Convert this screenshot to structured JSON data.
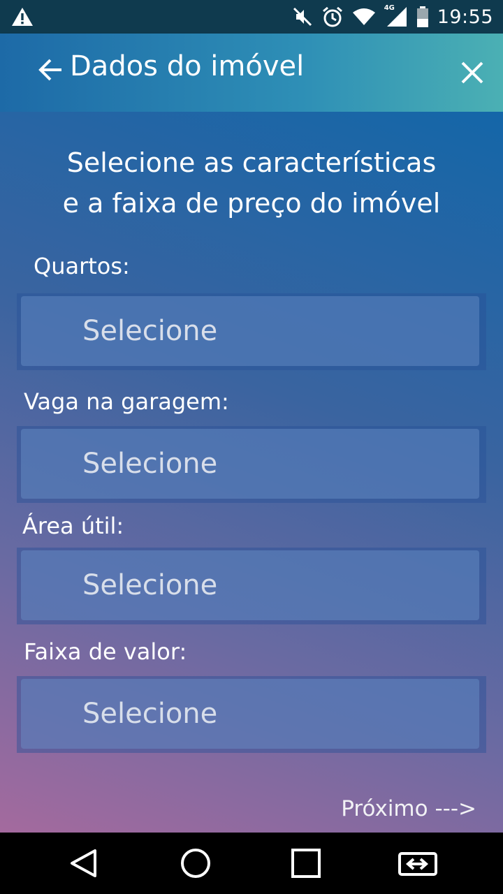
{
  "status_bar": {
    "time": "19:55",
    "network_label": "4G",
    "icons": [
      "warning-icon",
      "mute-icon",
      "alarm-icon",
      "wifi-icon",
      "signal-icon",
      "battery-icon"
    ]
  },
  "toolbar": {
    "title": "Dados do imóvel",
    "back_icon": "arrow-left-icon",
    "close_icon": "close-icon"
  },
  "form": {
    "heading_line1": "Selecione as características",
    "heading_line2": "e a faixa de preço do imóvel",
    "fields": [
      {
        "label": "Quartos:",
        "value": "Selecione"
      },
      {
        "label": "Vaga na garagem:",
        "value": "Selecione"
      },
      {
        "label": "Área útil:",
        "value": "Selecione"
      },
      {
        "label": "Faixa de valor:",
        "value": "Selecione"
      }
    ],
    "next_label": "Próximo --->"
  },
  "nav_bar": {
    "icons": [
      "back-triangle-icon",
      "home-circle-icon",
      "recents-square-icon",
      "rotate-screen-icon"
    ]
  },
  "colors": {
    "status_bar": "#0f3a4e",
    "toolbar_start": "#1d6aa7",
    "toolbar_end": "#4bb0b4",
    "background_top": "#1466a8",
    "background_bottom": "#a46a9e"
  }
}
